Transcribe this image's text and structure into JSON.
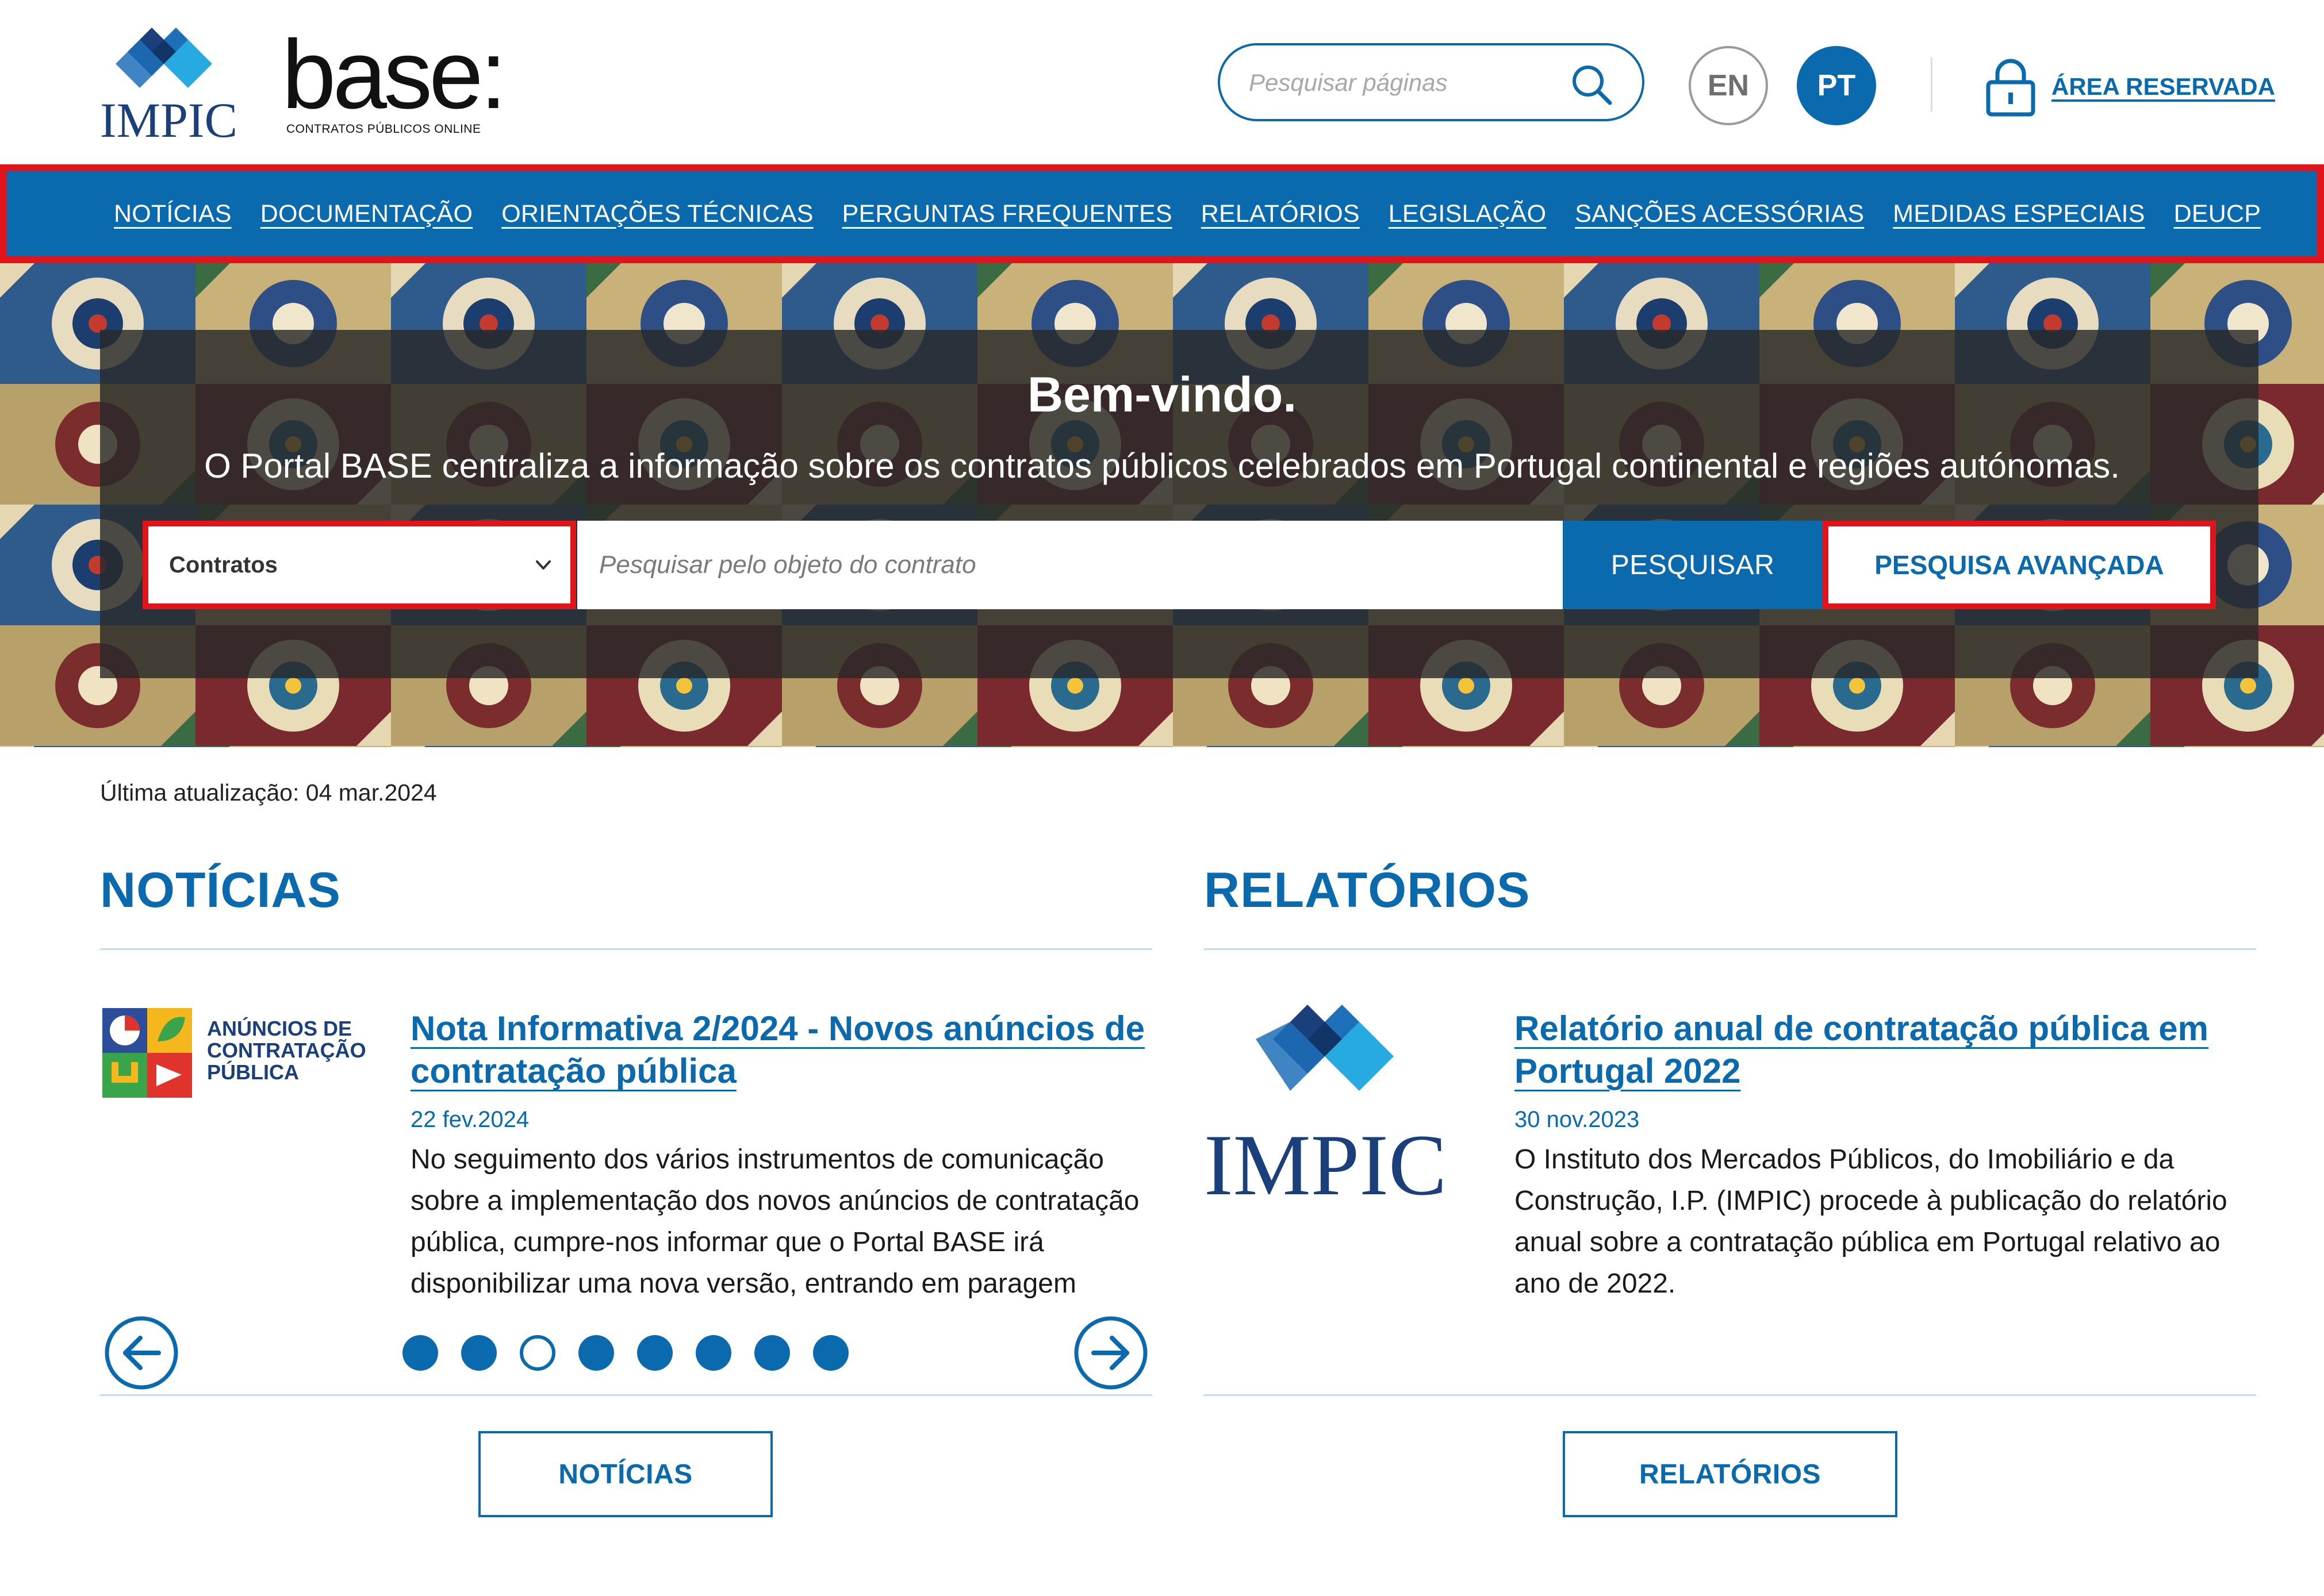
{
  "header": {
    "impic_logo_text": "IMPIC",
    "base_logo_text": "base:",
    "base_logo_subtitle": "CONTRATOS PÚBLICOS ONLINE",
    "search_placeholder": "Pesquisar páginas",
    "lang_en": "EN",
    "lang_pt": "PT",
    "reserved_area": "ÁREA RESERVADA"
  },
  "nav": {
    "items": [
      {
        "label": "NOTÍCIAS"
      },
      {
        "label": "DOCUMENTAÇÃO"
      },
      {
        "label": "ORIENTAÇÕES TÉCNICAS"
      },
      {
        "label": "PERGUNTAS FREQUENTES"
      },
      {
        "label": "RELATÓRIOS"
      },
      {
        "label": "LEGISLAÇÃO"
      },
      {
        "label": "SANÇÕES ACESSÓRIAS"
      },
      {
        "label": "MEDIDAS ESPECIAIS"
      },
      {
        "label": "DEUCP"
      }
    ]
  },
  "hero": {
    "title": "Bem-vindo.",
    "subtitle": "O Portal BASE centraliza a informação sobre os contratos públicos celebrados em Portugal continental e regiões autónomas.",
    "select_value": "Contratos",
    "search_placeholder": "Pesquisar pelo objeto do contrato",
    "search_button": "PESQUISAR",
    "advanced_button": "PESQUISA AVANÇADA"
  },
  "last_update": "Última atualização: 04 mar.2024",
  "news": {
    "section_title": "NOTÍCIAS",
    "image_caption_lines": [
      "ANÚNCIOS DE",
      "CONTRATAÇÃO",
      "PÚBLICA"
    ],
    "title_lines": [
      "Nota Informativa 2/2024 - Novos anúncios de",
      "contratação pública"
    ],
    "date": "22 fev.2024",
    "body_lines": [
      "No seguimento dos vários instrumentos de comunicação",
      "sobre a implementação dos novos anúncios de contratação",
      "pública, cumpre-nos informar que o Portal BASE irá",
      "disponibilizar uma nova versão, entrando em paragem"
    ],
    "carousel": {
      "total": 8,
      "active_index": 3
    },
    "more_button": "NOTÍCIAS"
  },
  "reports": {
    "section_title": "RELATÓRIOS",
    "image_text": "IMPIC",
    "title_lines": [
      "Relatório anual de contratação pública em",
      "Portugal 2022"
    ],
    "date": "30 nov.2023",
    "body_lines": [
      "O Instituto dos Mercados Públicos, do Imobiliário e da",
      "Construção, I.P. (IMPIC) procede à publicação do relatório",
      "anual sobre a contratação pública em Portugal relativo ao",
      "ano de 2022."
    ],
    "more_button": "RELATÓRIOS"
  },
  "colors": {
    "brand_blue": "#0a6aad",
    "highlight_red": "#e0141a",
    "impic_dark": "#1a3f7a",
    "impic_mid": "#1d6fb8",
    "impic_light": "#27a9e1"
  },
  "icons": {
    "search": "magnifier-icon",
    "lock": "lock-icon",
    "select_chevron": "chevron-down-icon",
    "carousel_prev": "arrow-left-circle-icon",
    "carousel_next": "arrow-right-circle-icon"
  }
}
